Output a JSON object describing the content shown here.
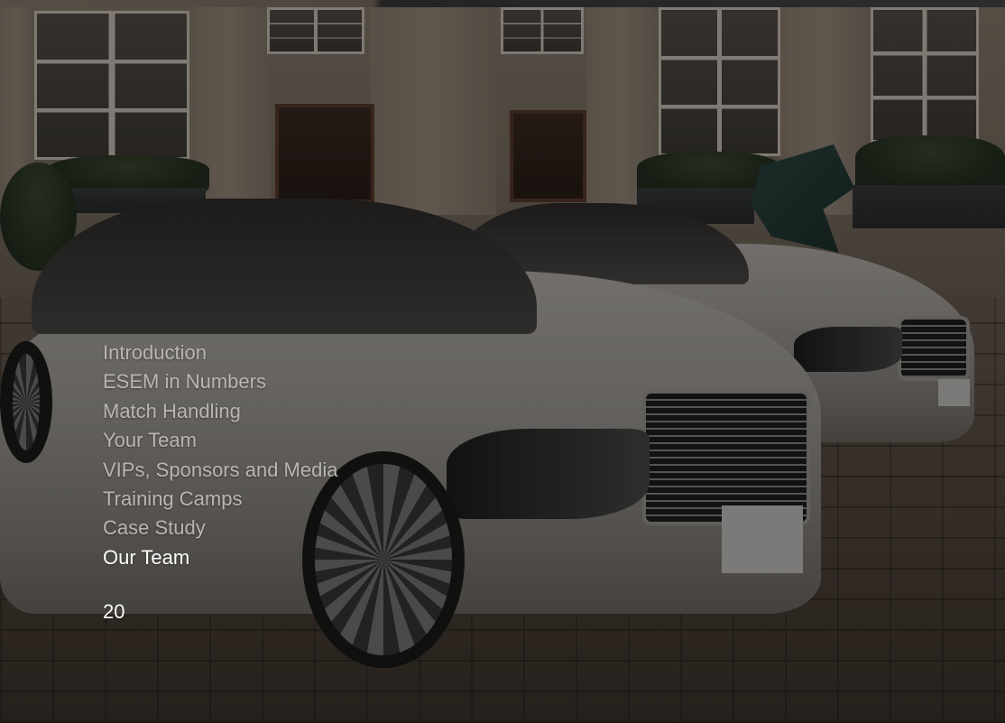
{
  "navigation": {
    "items": [
      {
        "label": "Introduction",
        "active": false
      },
      {
        "label": "ESEM in Numbers",
        "active": false
      },
      {
        "label": "Match Handling",
        "active": false
      },
      {
        "label": "Your Team",
        "active": false
      },
      {
        "label": "VIPs, Sponsors and Media",
        "active": false
      },
      {
        "label": "Training Camps",
        "active": false
      },
      {
        "label": "Case Study",
        "active": false
      },
      {
        "label": "Our Team",
        "active": true
      }
    ]
  },
  "page": {
    "number": "20"
  },
  "colors": {
    "nav_inactive": "#b9b6b1",
    "nav_active": "#ffffff"
  }
}
